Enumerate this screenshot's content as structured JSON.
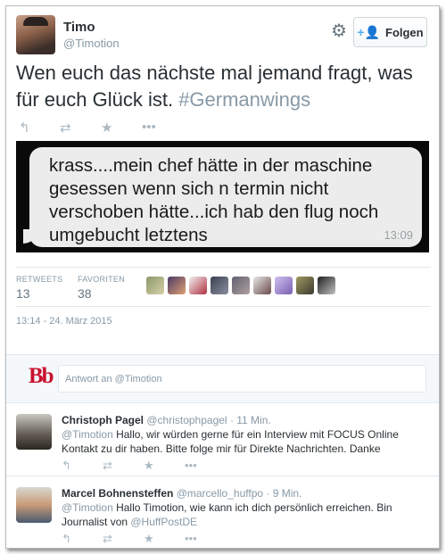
{
  "tweet": {
    "name": "Timo",
    "handle": "@Timotion",
    "follow_label": "Folgen",
    "text_main": "Wen euch das nächste mal jemand fragt, was für euch Glück ist. ",
    "hashtag": "#Germanwings",
    "actions": [
      "reply-icon",
      "retweet-icon",
      "favorite-icon"
    ],
    "media": {
      "message": "krass....mein chef hätte in der maschine gesessen wenn sich n termin nicht verschoben hätte...ich hab den flug noch umgebucht letztens",
      "time": "13:09"
    },
    "stats": {
      "retweets_label": "RETWEETS",
      "retweets_value": "13",
      "favorites_label": "FAVORITEN",
      "favorites_value": "38"
    },
    "timestamp": "13:14 - 24. März 2015"
  },
  "reply_box": {
    "placeholder_prefix": "Antwort an ",
    "placeholder_handle": "@Timotion",
    "logo": "Bb"
  },
  "replies": [
    {
      "name": "Christoph Pagel",
      "handle": "@christophpagel",
      "time": "· 11 Min.",
      "mention": "@Timotion",
      "text": " Hallo, wir würden gerne für ein Interview mit FOCUS Online Kontakt zu dir haben. Bitte folge mir für Direkte Nachrichten. Danke"
    },
    {
      "name": "Marcel Bohnensteffen",
      "handle": "@marcello_huffpo",
      "time": "· 9 Min.",
      "mention": "@Timotion",
      "text": " Hallo Timotion, wie kann ich dich persönlich erreichen. Bin Journalist von ",
      "mention2": "@HuffPostDE"
    }
  ],
  "colors": {
    "accent": "#55acee",
    "muted": "#8899a6",
    "text": "#292f33",
    "bild_red": "#c8102e"
  }
}
